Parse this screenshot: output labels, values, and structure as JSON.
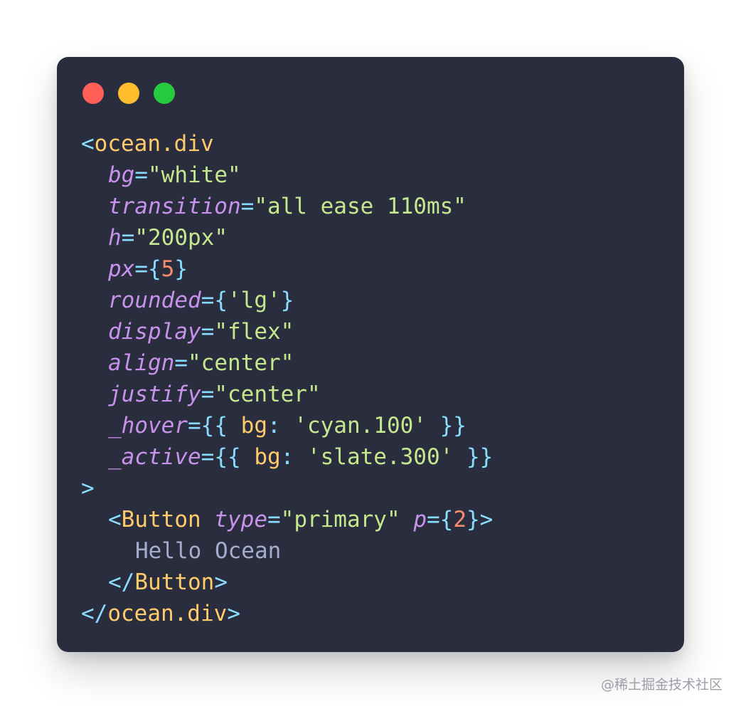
{
  "colors": {
    "window_bg": "#292d3e",
    "punctuation": "#89ddff",
    "tag": "#ffcb6b",
    "attribute": "#c792ea",
    "string": "#c3e88d",
    "number": "#f78c6c",
    "text": "#a6accd",
    "close_dot": "#ff5f56",
    "minimize_dot": "#ffbd2e",
    "maximize_dot": "#27c93f"
  },
  "window_controls": [
    "close-dot",
    "minimize-dot",
    "maximize-dot"
  ],
  "code": {
    "lines": [
      {
        "indent": 0,
        "tokens": [
          {
            "t": "<",
            "c": "punct"
          },
          {
            "t": "ocean.div",
            "c": "tag"
          }
        ]
      },
      {
        "indent": 1,
        "tokens": [
          {
            "t": "bg",
            "c": "attr"
          },
          {
            "t": "=",
            "c": "punct"
          },
          {
            "t": "\"white\"",
            "c": "str"
          }
        ]
      },
      {
        "indent": 1,
        "tokens": [
          {
            "t": "transition",
            "c": "attr"
          },
          {
            "t": "=",
            "c": "punct"
          },
          {
            "t": "\"all ease 110ms\"",
            "c": "str"
          }
        ]
      },
      {
        "indent": 1,
        "tokens": [
          {
            "t": "h",
            "c": "attr"
          },
          {
            "t": "=",
            "c": "punct"
          },
          {
            "t": "\"200px\"",
            "c": "str"
          }
        ]
      },
      {
        "indent": 1,
        "tokens": [
          {
            "t": "px",
            "c": "attr"
          },
          {
            "t": "=",
            "c": "punct"
          },
          {
            "t": "{",
            "c": "punct"
          },
          {
            "t": "5",
            "c": "num"
          },
          {
            "t": "}",
            "c": "punct"
          }
        ]
      },
      {
        "indent": 1,
        "tokens": [
          {
            "t": "rounded",
            "c": "attr"
          },
          {
            "t": "=",
            "c": "punct"
          },
          {
            "t": "{",
            "c": "punct"
          },
          {
            "t": "'lg'",
            "c": "str"
          },
          {
            "t": "}",
            "c": "punct"
          }
        ]
      },
      {
        "indent": 1,
        "tokens": [
          {
            "t": "display",
            "c": "attr"
          },
          {
            "t": "=",
            "c": "punct"
          },
          {
            "t": "\"flex\"",
            "c": "str"
          }
        ]
      },
      {
        "indent": 1,
        "tokens": [
          {
            "t": "align",
            "c": "attr"
          },
          {
            "t": "=",
            "c": "punct"
          },
          {
            "t": "\"center\"",
            "c": "str"
          }
        ]
      },
      {
        "indent": 1,
        "tokens": [
          {
            "t": "justify",
            "c": "attr"
          },
          {
            "t": "=",
            "c": "punct"
          },
          {
            "t": "\"center\"",
            "c": "str"
          }
        ]
      },
      {
        "indent": 1,
        "tokens": [
          {
            "t": "_hover",
            "c": "attr"
          },
          {
            "t": "=",
            "c": "punct"
          },
          {
            "t": "{{ ",
            "c": "punct"
          },
          {
            "t": "bg",
            "c": "key"
          },
          {
            "t": ": ",
            "c": "punct"
          },
          {
            "t": "'cyan.100'",
            "c": "str"
          },
          {
            "t": " }}",
            "c": "punct"
          }
        ]
      },
      {
        "indent": 1,
        "tokens": [
          {
            "t": "_active",
            "c": "attr"
          },
          {
            "t": "=",
            "c": "punct"
          },
          {
            "t": "{{ ",
            "c": "punct"
          },
          {
            "t": "bg",
            "c": "key"
          },
          {
            "t": ": ",
            "c": "punct"
          },
          {
            "t": "'slate.300'",
            "c": "str"
          },
          {
            "t": " }}",
            "c": "punct"
          }
        ]
      },
      {
        "indent": 0,
        "tokens": [
          {
            "t": ">",
            "c": "punct"
          }
        ]
      },
      {
        "indent": 1,
        "tokens": [
          {
            "t": "<",
            "c": "punct"
          },
          {
            "t": "Button",
            "c": "tag"
          },
          {
            "t": " ",
            "c": "text"
          },
          {
            "t": "type",
            "c": "attr"
          },
          {
            "t": "=",
            "c": "punct"
          },
          {
            "t": "\"primary\"",
            "c": "str"
          },
          {
            "t": " ",
            "c": "text"
          },
          {
            "t": "p",
            "c": "attr"
          },
          {
            "t": "=",
            "c": "punct"
          },
          {
            "t": "{",
            "c": "punct"
          },
          {
            "t": "2",
            "c": "num"
          },
          {
            "t": "}>",
            "c": "punct"
          }
        ]
      },
      {
        "indent": 2,
        "tokens": [
          {
            "t": "Hello Ocean",
            "c": "text"
          }
        ]
      },
      {
        "indent": 1,
        "tokens": [
          {
            "t": "</",
            "c": "punct"
          },
          {
            "t": "Button",
            "c": "tag"
          },
          {
            "t": ">",
            "c": "punct"
          }
        ]
      },
      {
        "indent": 0,
        "tokens": [
          {
            "t": "</",
            "c": "punct"
          },
          {
            "t": "ocean.div",
            "c": "tag"
          },
          {
            "t": ">",
            "c": "punct"
          }
        ]
      }
    ]
  },
  "watermark": "@稀土掘金技术社区"
}
